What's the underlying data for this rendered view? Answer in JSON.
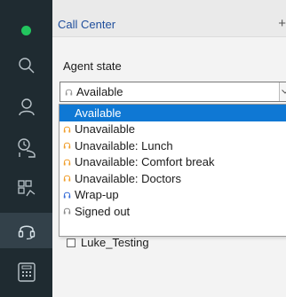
{
  "sidebar": {
    "items": [
      {
        "icon": "presence-dot-icon",
        "color": "#22c55e"
      },
      {
        "icon": "search-icon"
      },
      {
        "icon": "contacts-icon"
      },
      {
        "icon": "call-history-icon"
      },
      {
        "icon": "apps-icon"
      },
      {
        "icon": "headset-icon",
        "active": true
      },
      {
        "icon": "dialpad-icon"
      }
    ]
  },
  "header": {
    "title": "Call Center",
    "add_label": "+"
  },
  "agent_state": {
    "label": "Agent state",
    "selected_value": "Available",
    "options": [
      {
        "label": "Available",
        "icon": "headset-icon",
        "color": "#2e9e4f",
        "selected": true
      },
      {
        "label": "Unavailable",
        "icon": "headset-icon",
        "color": "#f0a030"
      },
      {
        "label": "Unavailable: Lunch",
        "icon": "headset-icon",
        "color": "#f0a030"
      },
      {
        "label": "Unavailable: Comfort break",
        "icon": "headset-icon",
        "color": "#f0a030"
      },
      {
        "label": "Unavailable: Doctors",
        "icon": "headset-icon",
        "color": "#f0a030"
      },
      {
        "label": "Wrap-up",
        "icon": "headset-icon",
        "color": "#3a6fd8"
      },
      {
        "label": "Signed out",
        "icon": "headset-icon",
        "color": "#8a8a8a"
      }
    ]
  },
  "tree": {
    "item_label": "Luke_Testing"
  }
}
